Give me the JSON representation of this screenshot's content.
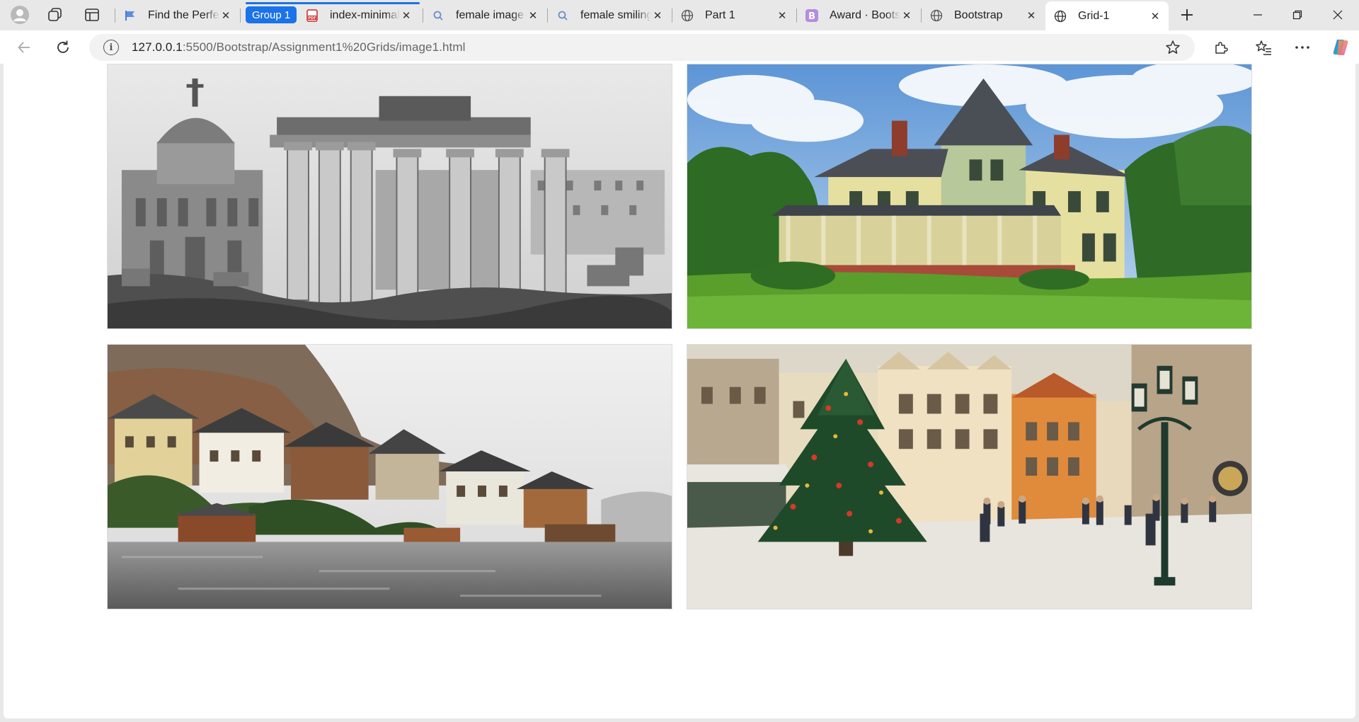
{
  "browser": {
    "group_label": "Group 1",
    "tabs": [
      {
        "title": "Find the Perfect",
        "icon": "flag-icon"
      },
      {
        "title": "index-minimal",
        "icon": "pdf-icon"
      },
      {
        "title": "female image",
        "icon": "search-icon"
      },
      {
        "title": "female smiling",
        "icon": "search-icon"
      },
      {
        "title": "Part 1",
        "icon": "globe-icon"
      },
      {
        "title": "Award · Bootstrap",
        "icon": "bootstrap-icon"
      },
      {
        "title": "Bootstrap",
        "icon": "globe-icon"
      },
      {
        "title": "Grid-1",
        "icon": "globe-icon"
      }
    ],
    "address": {
      "host": "127.0.0.1",
      "rest": ":5500/Bootstrap/Assignment1%20Grids/image1.html"
    }
  },
  "page": {
    "images": [
      {
        "name": "roman-forum-photo",
        "subject": "Black and white photo of ancient Roman temple columns"
      },
      {
        "name": "victorian-house-photo",
        "subject": "Yellow Victorian house with green trim and lawn"
      },
      {
        "name": "lakeside-village-photo",
        "subject": "Misty lakeside village with wooden houses"
      },
      {
        "name": "christmas-square-photo",
        "subject": "Christmas tree in snowy old town square with lamp post"
      }
    ]
  },
  "colors": {
    "accent": "#1a73e8",
    "chrome": "#e8e8e8",
    "omnibox": "#f2f2f2"
  }
}
